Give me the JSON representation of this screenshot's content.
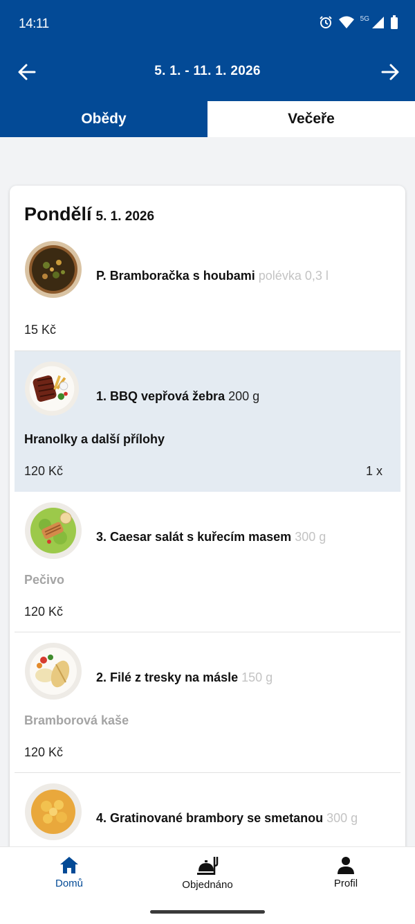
{
  "status": {
    "time": "14:11",
    "network": "5G"
  },
  "header": {
    "week_range": "5. 1. - 11. 1. 2026"
  },
  "tabs": [
    {
      "label": "Obědy",
      "active": false
    },
    {
      "label": "Večeře",
      "active": true
    }
  ],
  "day": {
    "name": "Pondělí",
    "date": "5. 1. 2026"
  },
  "meals": [
    {
      "title": "P. Bramboračka s houbami",
      "weight": "polévka 0,3 l",
      "side": "",
      "price": "15 Kč",
      "quantity": "",
      "selected": false,
      "image": "soup-bowl"
    },
    {
      "title": "1. BBQ vepřová žebra",
      "weight": "200 g",
      "side": "Hranolky a další přílohy",
      "price": "120 Kč",
      "quantity": "1 x",
      "selected": true,
      "image": "ribs-plate"
    },
    {
      "title": "3. Caesar salát s kuřecím masem",
      "weight": "300 g",
      "side": "Pečivo",
      "price": "120 Kč",
      "quantity": "",
      "selected": false,
      "image": "salad-plate"
    },
    {
      "title": "2. Filé z tresky na másle",
      "weight": "150 g",
      "side": "Bramborová kaše",
      "price": "120 Kč",
      "quantity": "",
      "selected": false,
      "image": "fish-plate"
    },
    {
      "title": "4. Gratinované brambory se smetanou",
      "weight": "300 g",
      "side": "",
      "price": "",
      "quantity": "",
      "selected": false,
      "image": "potatoes-plate"
    }
  ],
  "bottom_nav": [
    {
      "label": "Domů",
      "icon": "home-icon",
      "active": true
    },
    {
      "label": "Objednáno",
      "icon": "food-tray-icon",
      "active": false
    },
    {
      "label": "Profil",
      "icon": "person-icon",
      "active": false
    }
  ],
  "colors": {
    "primary": "#034a96",
    "selected_row": "#e4ebf2",
    "muted_text": "#a4a4a4"
  }
}
